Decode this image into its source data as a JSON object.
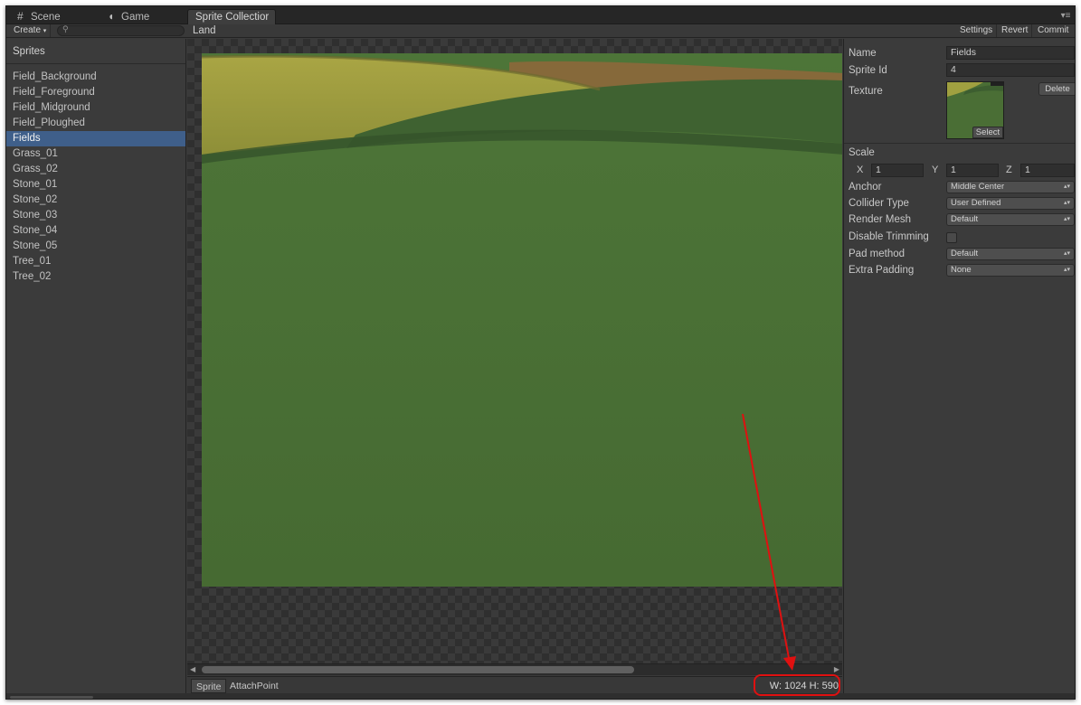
{
  "tabs": [
    {
      "label": "Scene",
      "icon": "grid-icon"
    },
    {
      "label": "Game",
      "icon": "pacman-icon"
    },
    {
      "label": "Sprite Collectior",
      "icon": ""
    }
  ],
  "toolbar": {
    "create_label": "Create",
    "create_arrow": "▾",
    "search_placeholder": "",
    "breadcrumb": "Land",
    "settings_label": "Settings",
    "revert_label": "Revert",
    "commit_label": "Commit"
  },
  "sprites": {
    "header": "Sprites",
    "items": [
      "Field_Background",
      "Field_Foreground",
      "Field_Midground",
      "Field_Ploughed",
      "Fields",
      "Grass_01",
      "Grass_02",
      "Stone_01",
      "Stone_02",
      "Stone_03",
      "Stone_04",
      "Stone_05",
      "Tree_01",
      "Tree_02"
    ],
    "selected": "Fields"
  },
  "preview": {
    "bottom_tabs": [
      "Sprite",
      "AttachPoint"
    ],
    "dimensions_text": "W: 1024 H: 590"
  },
  "inspector": {
    "name_label": "Name",
    "name_value": "Fields",
    "sprite_id_label": "Sprite Id",
    "sprite_id_value": "4",
    "texture_label": "Texture",
    "delete_label": "Delete",
    "select_label": "Select",
    "scale_label": "Scale",
    "scale_x_label": "X",
    "scale_x": "1",
    "scale_y_label": "Y",
    "scale_y": "1",
    "scale_z_label": "Z",
    "scale_z": "1",
    "anchor_label": "Anchor",
    "anchor_value": "Middle Center",
    "collider_label": "Collider Type",
    "collider_value": "User Defined",
    "render_mesh_label": "Render Mesh",
    "render_mesh_value": "Default",
    "disable_trimming_label": "Disable Trimming",
    "disable_trimming_checked": false,
    "pad_method_label": "Pad method",
    "pad_method_value": "Default",
    "extra_padding_label": "Extra Padding",
    "extra_padding_value": "None",
    "dropdown_arrows": "▴▾"
  },
  "colors": {
    "selection": "#3f5f8a",
    "annotation": "#e01010",
    "field_green": "#4a6e35",
    "field_yellow": "#9a9a3e"
  }
}
